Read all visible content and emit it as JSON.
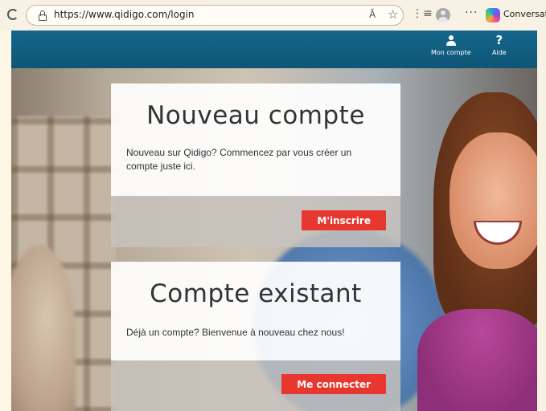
{
  "browser": {
    "url": "https://www.qidigo.com/login",
    "read_aloud_glyph": "Ȃ",
    "copilot_label": "Conversation",
    "icons": [
      "reload-icon",
      "lock-icon",
      "read-aloud-icon",
      "favorite-star-icon",
      "collections-icon",
      "profile-avatar",
      "more-icon",
      "copilot-icon"
    ]
  },
  "header": {
    "account_label": "Mon compte",
    "help_label": "Aide",
    "help_glyph": "?",
    "background_color": "#13658a"
  },
  "new_account": {
    "title": "Nouveau compte",
    "text": "Nouveau sur Qidigo? Commencez par vous créer un compte juste ici.",
    "button_label": "M'inscrire"
  },
  "existing_account": {
    "title": "Compte existant",
    "text": "Déjà un compte? Bienvenue à nouveau chez nous!",
    "button_label": "Me connecter"
  },
  "colors": {
    "button": "#e8372e",
    "browser_bg": "#f7f2e3"
  }
}
